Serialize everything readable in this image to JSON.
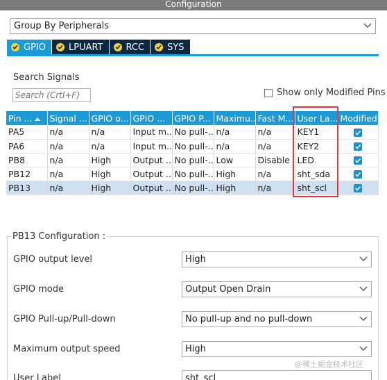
{
  "window": {
    "title": "Configuration"
  },
  "group_select": {
    "value": "Group By Peripherals"
  },
  "tabs": [
    {
      "label": "GPIO",
      "active": true
    },
    {
      "label": "LPUART",
      "active": false
    },
    {
      "label": "RCC",
      "active": false
    },
    {
      "label": "SYS",
      "active": false
    }
  ],
  "search": {
    "label": "Search Signals",
    "placeholder": "Search (Crtl+F)"
  },
  "filter": {
    "label": "Show only Modified Pins",
    "checked": false
  },
  "table": {
    "headers": [
      "Pin ...",
      "Signal ...",
      "GPIO o...",
      "GPIO ...",
      "GPIO P...",
      "Maximu...",
      "Fast M...",
      "User La...",
      "Modified"
    ],
    "rows": [
      {
        "cells": [
          "PA5",
          "n/a",
          "n/a",
          "Input m...",
          "No pull-...",
          "n/a",
          "n/a",
          "KEY1"
        ],
        "modified": true
      },
      {
        "cells": [
          "PA6",
          "n/a",
          "n/a",
          "Input m...",
          "No pull-...",
          "n/a",
          "n/a",
          "KEY2"
        ],
        "modified": true
      },
      {
        "cells": [
          "PB8",
          "n/a",
          "High",
          "Output ...",
          "No pull-...",
          "Low",
          "Disable",
          "LED"
        ],
        "modified": true
      },
      {
        "cells": [
          "PB12",
          "n/a",
          "High",
          "Output ...",
          "No pull-...",
          "High",
          "n/a",
          "sht_sda"
        ],
        "modified": true
      },
      {
        "cells": [
          "PB13",
          "n/a",
          "High",
          "Output ...",
          "No pull-...",
          "High",
          "n/a",
          "sht_scl"
        ],
        "modified": true
      }
    ],
    "selected_row": 4
  },
  "pin_config": {
    "title": "PB13 Configuration :",
    "fields": [
      {
        "label": "GPIO output level",
        "value": "High"
      },
      {
        "label": "GPIO mode",
        "value": "Output Open Drain"
      },
      {
        "label": "GPIO Pull-up/Pull-down",
        "value": "No pull-up and no pull-down"
      },
      {
        "label": "Maximum output speed",
        "value": "High"
      },
      {
        "label": "User Label",
        "value": "sht_scl"
      }
    ]
  },
  "watermark": "@稀土掘金技术社区",
  "colors": {
    "accent": "#1a9bd7",
    "tab_dark": "#0b2944",
    "highlight_box": "#e03a3a",
    "selected_row": "#cfe0f0"
  }
}
